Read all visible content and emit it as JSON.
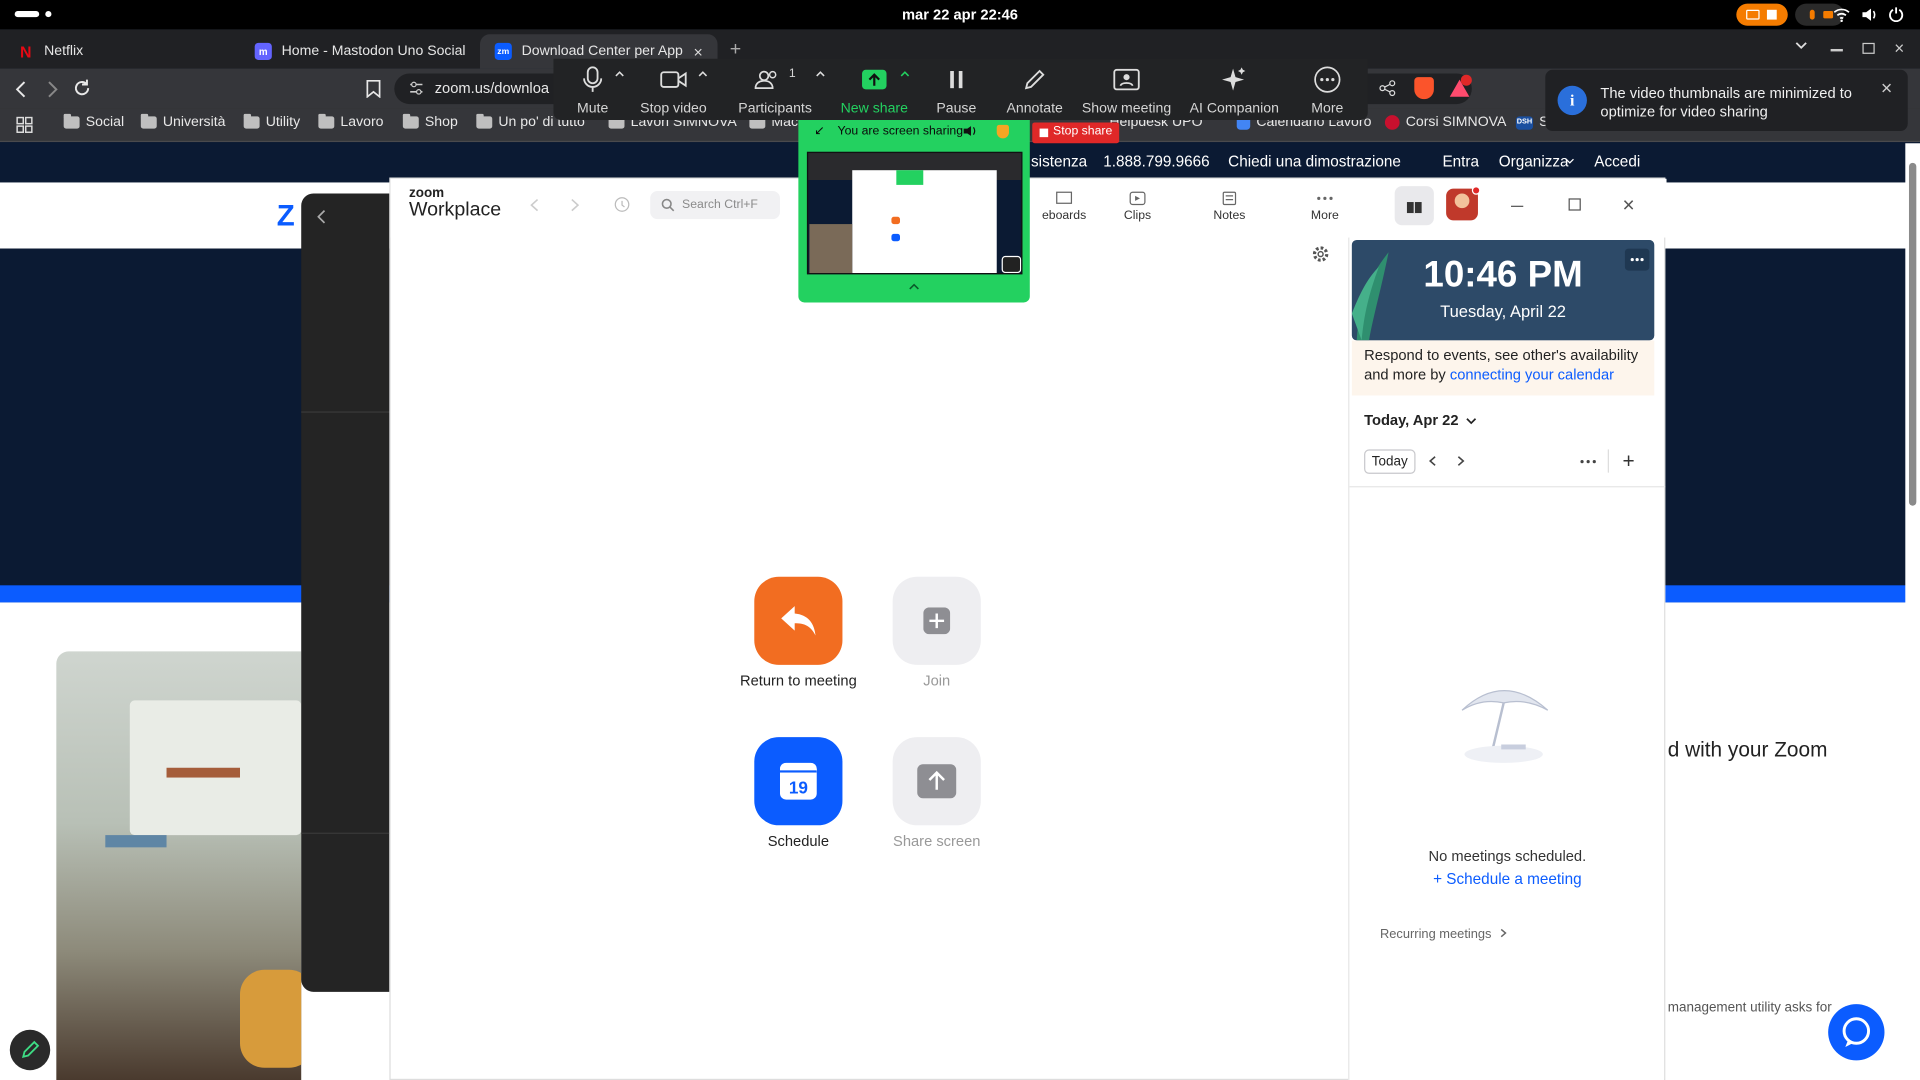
{
  "system": {
    "datetime": "mar 22 apr  22:46"
  },
  "tabs": [
    {
      "label": "Netflix",
      "icon": "netflix-icon"
    },
    {
      "label": "Home - Mastodon Uno Social",
      "icon": "mastodon-icon"
    },
    {
      "label": "Download Center per App",
      "icon": "zoom-icon"
    }
  ],
  "browser": {
    "url": "zoom.us/downloa"
  },
  "bookmarks": [
    "Social",
    "Università",
    "Utility",
    "Lavoro",
    "Shop",
    "Un po' di tutto",
    "Lavori SIMNOVA",
    "Mac",
    "Helpdesk UPO",
    "Calendario Lavoro",
    "Corsi SIMNOVA",
    "S"
  ],
  "zoom_controls": {
    "mute": "Mute",
    "stop_video": "Stop video",
    "participants": "Participants",
    "participants_count": "1",
    "new_share": "New share",
    "pause": "Pause",
    "annotate": "Annotate",
    "show_meeting": "Show meeting",
    "ai_companion": "AI Companion",
    "more": "More"
  },
  "share": {
    "status": "You are screen sharing",
    "stop": "Stop share"
  },
  "notification": {
    "text_line1": "The video thumbnails are minimized to",
    "text_line2": "optimize for video sharing"
  },
  "site_nav": {
    "support": "sistenza",
    "phone": "1.888.799.9666",
    "demo": "Chiedi una dimostrazione",
    "login": "Entra",
    "host": "Organizza",
    "signin": "Accedi"
  },
  "site_text": {
    "headline_fragment": "d with your Zoom",
    "body_fragment": "management utility asks for"
  },
  "zoom_app": {
    "brand_small": "zoom",
    "brand": "Workplace",
    "search_placeholder": "Search Ctrl+F",
    "top_items": [
      "eboards",
      "Clips",
      "Notes",
      "More"
    ],
    "home_buttons": {
      "return": "Return to meeting",
      "join": "Join",
      "schedule": "Schedule",
      "schedule_day": "19",
      "share_screen": "Share screen"
    }
  },
  "calendar": {
    "time": "10:46 PM",
    "date": "Tuesday, April 22",
    "respond_prefix": "Respond to events, see other's availability and more by ",
    "respond_link": "connecting your calendar",
    "today_heading": "Today, Apr 22",
    "today_btn": "Today",
    "empty": "No meetings scheduled.",
    "schedule_link": "Schedule a meeting",
    "recurring": "Recurring meetings"
  },
  "colors": {
    "zoom_orange": "#f26d21",
    "zoom_blue": "#0b5cff",
    "share_green": "#23d160",
    "stop_red": "#e02828"
  }
}
